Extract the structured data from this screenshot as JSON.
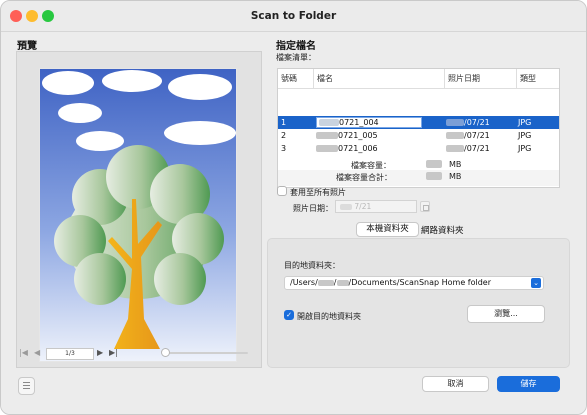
{
  "window": {
    "title": "Scan to Folder",
    "traffic_lights": {
      "close": "#ff5f57",
      "minimize": "#febc2e",
      "zoom": "#28c840"
    }
  },
  "preview": {
    "header": "預覽",
    "page_indicator": "1/3"
  },
  "filename": {
    "header": "指定檔名",
    "list_label": "檔案清單：",
    "columns": [
      "號碼",
      "檔名",
      "照片日期",
      "類型"
    ],
    "rows": [
      {
        "num": "1",
        "name_suffix": "0721_004",
        "date_suffix": "/07/21",
        "type": "JPG",
        "selected": true
      },
      {
        "num": "2",
        "name_suffix": "0721_005",
        "date_suffix": "/07/21",
        "type": "JPG",
        "selected": false
      },
      {
        "num": "3",
        "name_suffix": "0721_006",
        "date_suffix": "/07/21",
        "type": "JPG",
        "selected": false
      }
    ],
    "file_size_label": "檔案容量：",
    "file_size_unit": "MB",
    "total_size_label": "檔案容量合計：",
    "total_size_unit": "MB",
    "apply_all_label": "套用至所有照片",
    "photo_date_label": "照片日期：",
    "photo_date_value": "7/21"
  },
  "destination": {
    "tabs": [
      "本機資料夾",
      "網路資料夾"
    ],
    "folder_label": "目的地資料夾：",
    "path_prefix": "/Users/",
    "path_mid": "/",
    "path_suffix": "/Documents/ScanSnap Home folder",
    "open_folder_label": "開啟目的地資料夾",
    "browse_label": "瀏覽..."
  },
  "footer": {
    "cancel_label": "取消",
    "save_label": "儲存"
  },
  "colors": {
    "accent": "#1a6ddb",
    "selected_row": "#1a63c9"
  }
}
